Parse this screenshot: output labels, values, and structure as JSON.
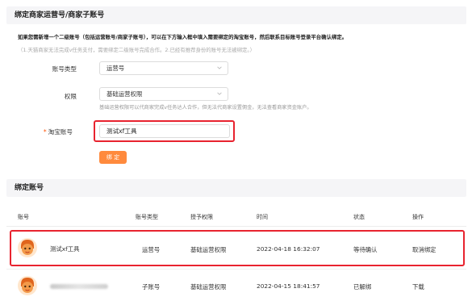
{
  "bind_section": {
    "title": "绑定商家运营号/商家子账号",
    "hint_main": "如果您需新增一个二级账号（包括运营账号/商家子账号），可以在下方输入框中填入需要绑定的淘宝账号，然后联系目标账号登录平台确认绑定。",
    "hint_sub": "（1.天猫商家无法完成v任务支付，需要绑定二级账号完成合作。2.已经有推荐身份的账号无法被绑定。）",
    "account_type_label": "账号类型",
    "account_type_value": "运营号",
    "permission_label": "权限",
    "permission_value": "基础运营权限",
    "permission_helper": "基础运营权限可以代商家完成v任务达人合作，但无法代商家设置佣金，无法查看商家资金账户。",
    "taobao_label": "淘宝账号",
    "required_mark": "*",
    "taobao_value": "测试xf工具",
    "bind_button": "绑 定"
  },
  "bound_section": {
    "title": "绑定账号",
    "columns": [
      "账号",
      "账号类型",
      "授予权限",
      "时间",
      "状态",
      "操作"
    ],
    "rows": [
      {
        "account": "测试xf工具",
        "type": "运营号",
        "permission": "基础运营权限",
        "time": "2022-04-18 16:32:07",
        "status": "等待确认",
        "action": "取消绑定"
      },
      {
        "account": "",
        "type": "子账号",
        "permission": "基础运营权限",
        "time": "2022-04-15 18:41:57",
        "status": "已解绑",
        "action": "下载"
      }
    ]
  },
  "colors": {
    "accent": "#ff8a3d",
    "highlight_border": "#e8232f",
    "header_bg": "#f5f5f7"
  },
  "icons": {
    "dropdown": "chevron-down-icon",
    "avatar": "cartoon-avatar-icon"
  }
}
